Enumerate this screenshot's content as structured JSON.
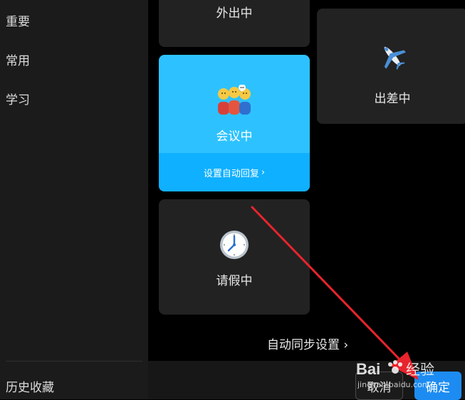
{
  "sidebar": {
    "items": [
      {
        "label": "重要"
      },
      {
        "label": "常用"
      },
      {
        "label": "学习"
      }
    ],
    "bottom_item": "历史收藏"
  },
  "status_cards": {
    "out": {
      "label": "外出中"
    },
    "business_trip": {
      "label": "出差中",
      "icon": "airplane-icon"
    },
    "meeting": {
      "label": "会议中",
      "icon": "people-meeting-icon",
      "reply_link": "设置自动回复",
      "selected": true
    },
    "leave": {
      "label": "请假中",
      "icon": "clock-icon"
    }
  },
  "sync_link": "自动同步设置",
  "footer": {
    "cancel_label": "取消",
    "ok_label": "确定"
  },
  "watermark": {
    "brand": "Bai",
    "paw": "du",
    "suffix": "经验",
    "url": "jingyan.baidu.com"
  },
  "colors": {
    "selected_card": "#2dc2ff",
    "reply_bar": "#0fb0ff",
    "primary_button": "#1d8cf2",
    "annotation_arrow": "#e8242c"
  }
}
